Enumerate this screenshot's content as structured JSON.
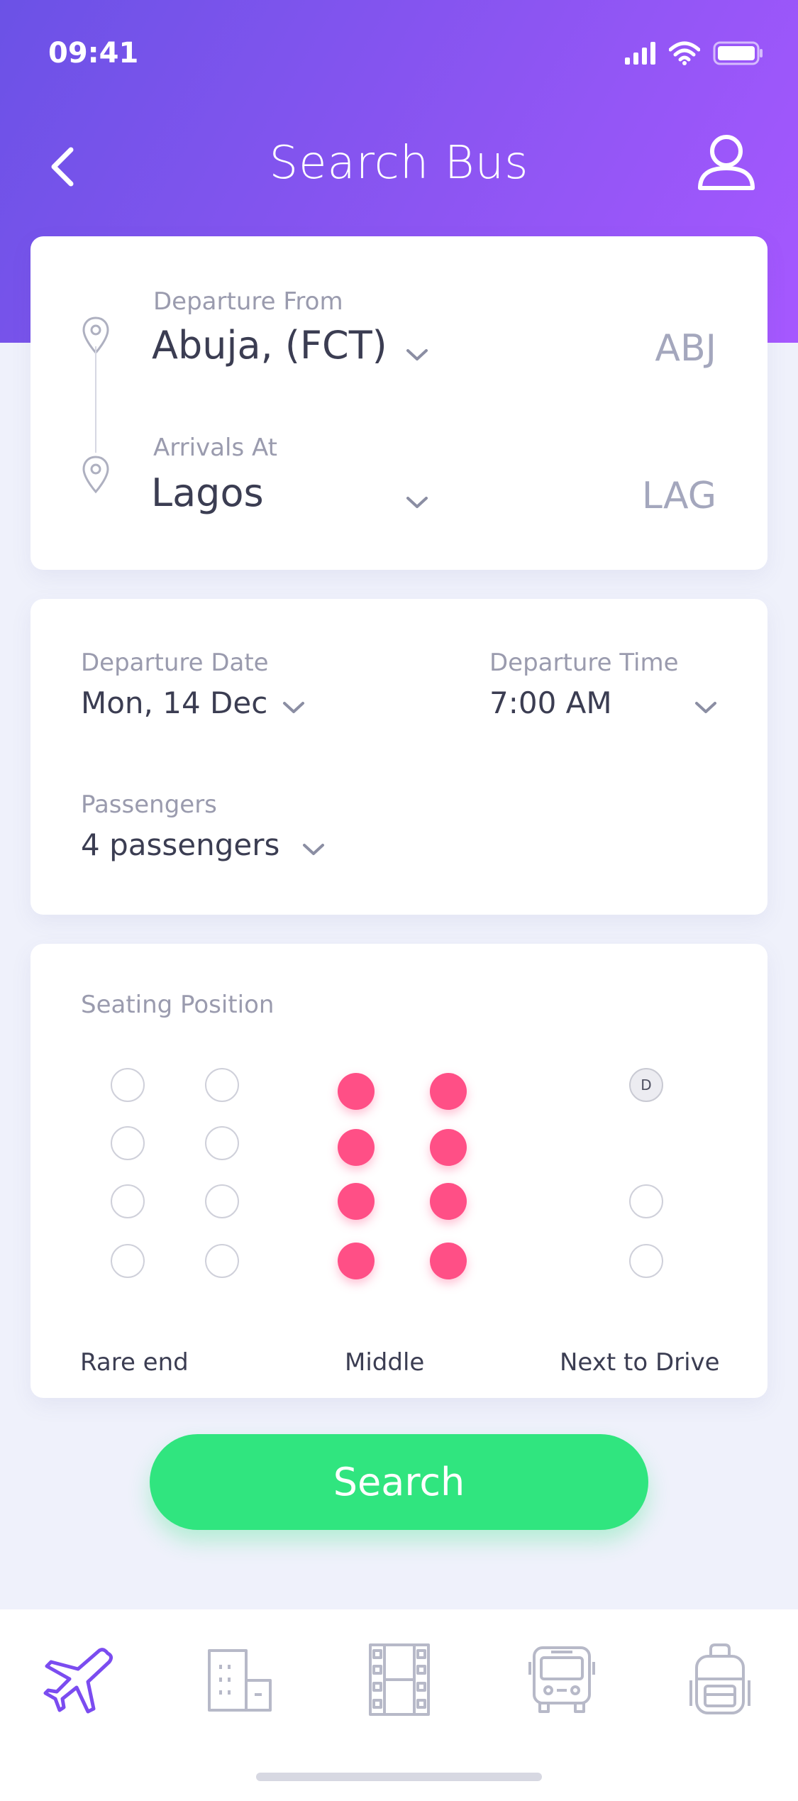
{
  "status": {
    "time": "09:41"
  },
  "nav": {
    "title": "Search Bus"
  },
  "route": {
    "departure_label": "Departure From",
    "departure_value": "Abuja, (FCT)",
    "departure_code": "ABJ",
    "arrival_label": "Arrivals At",
    "arrival_value": "Lagos",
    "arrival_code": "LAG"
  },
  "trip": {
    "date_label": "Departure Date",
    "date_value": "Mon, 14 Dec",
    "time_label": "Departure Time",
    "time_value": "7:00 AM",
    "passengers_label": "Passengers",
    "passengers_value": "4 passengers"
  },
  "seating": {
    "title": "Seating Position",
    "driver_badge": "D",
    "labels": {
      "rear": "Rare end",
      "middle": "Middle",
      "front": "Next to Drive"
    },
    "selected_group": "Middle"
  },
  "search_button": "Search",
  "tabs": [
    {
      "icon": "airplane-icon",
      "active": true
    },
    {
      "icon": "hotel-icon",
      "active": false
    },
    {
      "icon": "film-icon",
      "active": false
    },
    {
      "icon": "bus-icon",
      "active": false
    },
    {
      "icon": "backpack-icon",
      "active": false
    }
  ],
  "colors": {
    "header_gradient_start": "#6b52e6",
    "header_gradient_end": "#a658ff",
    "seat_selected": "#ff4f86",
    "search_button": "#30e57f",
    "active_tab": "#7b4cf0",
    "inactive_tab": "#b7b9c8"
  }
}
